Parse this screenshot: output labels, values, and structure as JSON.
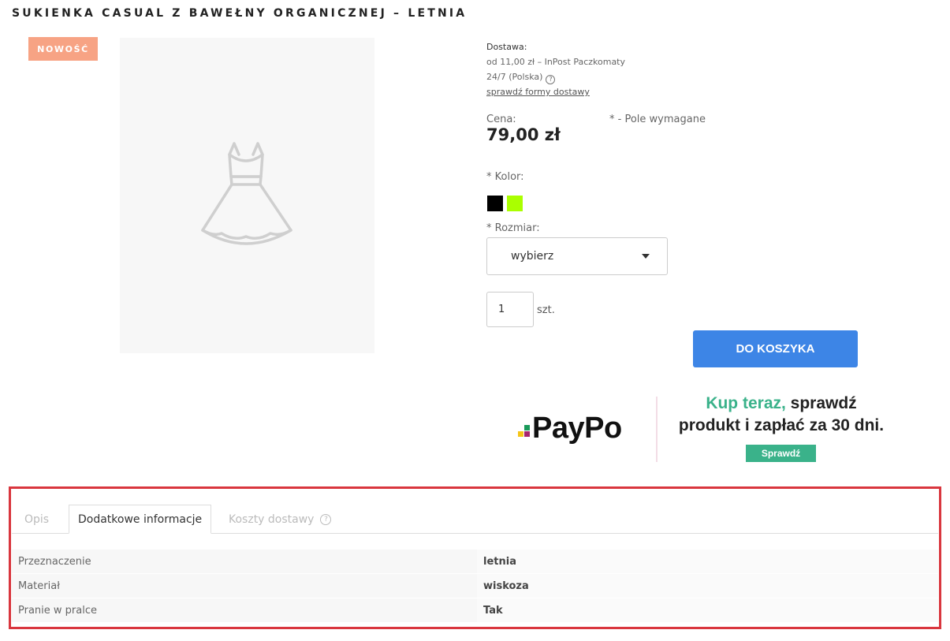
{
  "product": {
    "title": "SUKIENKA CASUAL Z BAWEŁNY ORGANICZNEJ – LETNIA",
    "badge": "NOWOŚĆ",
    "image_icon": "dress-icon"
  },
  "delivery": {
    "label": "Dostawa:",
    "line1": "od 11,00 zł – InPost Paczkomaty",
    "line2": "24/7 (Polska)",
    "link": "sprawdź formy dostawy"
  },
  "price": {
    "label": "Cena:",
    "value": "79,00 zł",
    "required_note": "* - Pole wymagane"
  },
  "options": {
    "color_label": "* Kolor:",
    "colors": [
      "#000000",
      "#aaff00"
    ],
    "size_label": "* Rozmiar:",
    "size_selected": "wybierz"
  },
  "quantity": {
    "value": "1",
    "unit": "szt."
  },
  "cart": {
    "button_label": "DO KOSZYKA",
    "button_color": "#3d85e6"
  },
  "paypo": {
    "logo_text": "PayPo",
    "tagline_green": "Kup teraz,",
    "tagline_rest": " sprawdź",
    "tagline_line2": "produkt i zapłać za 30 dni.",
    "button_label": "Sprawdź",
    "accent": "#3ab28a"
  },
  "tabs": [
    {
      "label": "Opis"
    },
    {
      "label": "Dodatkowe informacje"
    },
    {
      "label": "Koszty dostawy"
    }
  ],
  "info_table": [
    {
      "key": "Przeznaczenie",
      "value": "letnia"
    },
    {
      "key": "Materiał",
      "value": "wiskoza"
    },
    {
      "key": "Pranie w pralce",
      "value": "Tak"
    }
  ]
}
